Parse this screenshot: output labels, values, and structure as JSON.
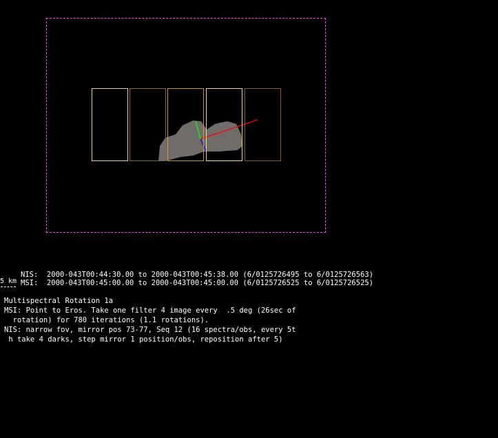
{
  "obs": {
    "nis_line": "NIS:  2000-043T00:44:30.00 to 2000-043T00:45:38.00 (6/0125726495 to 6/0125726563)",
    "msi_line": "MSI:  2000-043T00:45:00.00 to 2000-043T00:45:00.00 (6/0125726525 to 6/0125726525)",
    "scale_label": "5 km"
  },
  "description": {
    "title": "Multispectral Rotation 1a",
    "lines": [
      "MSI: Point to Eros. Take one filter 4 image every  .5 deg (26sec of",
      "  rotation) for 780 iterations (1.1 rotations).",
      "NIS: narrow fov, mirror pos 73-77, Seq 12 (16 spectra/obs, every 5t",
      " h take 4 darks, step mirror 1 position/obs, reposition after 5)"
    ]
  },
  "colors": {
    "frame": "#ff40ff",
    "asteroid": "#706c6a",
    "footprints": [
      "#f0d080",
      "#8a6a20",
      "#c8982a",
      "#f0d880",
      "#8a5a18"
    ]
  }
}
